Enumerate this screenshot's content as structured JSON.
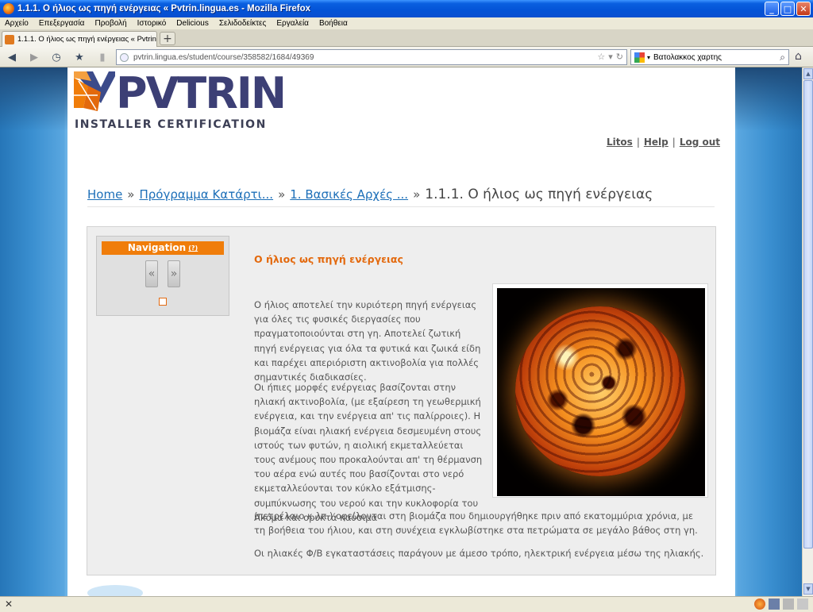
{
  "window": {
    "title": "1.1.1. Ο ήλιος ως πηγή ενέργειας « Pvtrin.lingua.es - Mozilla Firefox",
    "buttons": [
      "_",
      "□",
      "✕"
    ]
  },
  "menubar": [
    "Αρχείο",
    "Επεξεργασία",
    "Προβολή",
    "Ιστορικό",
    "Delicious",
    "Σελιδοδείκτες",
    "Εργαλεία",
    "Βοήθεια"
  ],
  "tab": {
    "label": "1.1.1. Ο ήλιος ως πηγή ενέργειας « Pvtrin.li...",
    "newtab": "+"
  },
  "navbar": {
    "url": "pvtrin.lingua.es/student/course/358582/1684/49369",
    "search_value": "Βατολακκος χαρτης"
  },
  "site": {
    "brand": "PVTRIN",
    "subtitle": "INSTALLER CERTIFICATION",
    "toplinks": [
      "Litos",
      "Help",
      "Log out"
    ]
  },
  "breadcrumbs": {
    "items": [
      "Home",
      "Πρόγραμμα Κατάρτι...",
      "1. Βασικές Αρχές ..."
    ],
    "current": "1.1.1. Ο ήλιος ως πηγή ενέργειας"
  },
  "navigation": {
    "title": "Navigation",
    "help": "(?)",
    "prev": "«",
    "next": "»"
  },
  "article": {
    "title": "Ο ήλιος ως πηγή ενέργειας",
    "p1": "Ο ήλιος αποτελεί την κυριότερη πηγή ενέργειας για όλες τις φυσικές διεργασίες που πραγματοποιούνται στη γη. Αποτελεί ζωτική πηγή ενέργειας για όλα τα φυτικά και ζωικά είδη και παρέχει απεριόριστη ακτινοβολία για πολλές σημαντικές διαδικασίες.",
    "p2": "Οι ήπιες μορφές ενέργειας βασίζονται στην ηλιακή ακτινοβολία, (με εξαίρεση τη γεωθερμική ενέργεια, και την ενέργεια απ' τις παλίρροιες). Η βιομάζα είναι ηλιακή ενέργεια δεσμευμένη στους ιστούς των φυτών, η αιολική εκμεταλλεύεται τους ανέμους που προκαλούνται απ' τη θέρμανση του αέρα ενώ αυτές που βασίζονται στο νερό εκμεταλλεύονται τον κύκλο εξάτμισης-συμπύκνωσης του νερού και την κυκλοφορία του Ακόμα και ορυκτά καύσιμα",
    "p2b": "(πετρέλαιο κ.λπ.) οφείλονται στη βιομάζα που δημιουργήθηκε πριν από εκατομμύρια χρόνια, με τη βοήθεια του ήλιου, και στη συνέχεια εγκλωβίστηκε στα πετρώματα σε μεγάλο βάθος στη γη.",
    "p3": "Οι ηλιακές Φ/Β εγκαταστάσεις παράγουν με άμεσο τρόπο, ηλεκτρική ενέργεια μέσω της ηλιακής."
  },
  "statusbar": {
    "left": "✕"
  }
}
